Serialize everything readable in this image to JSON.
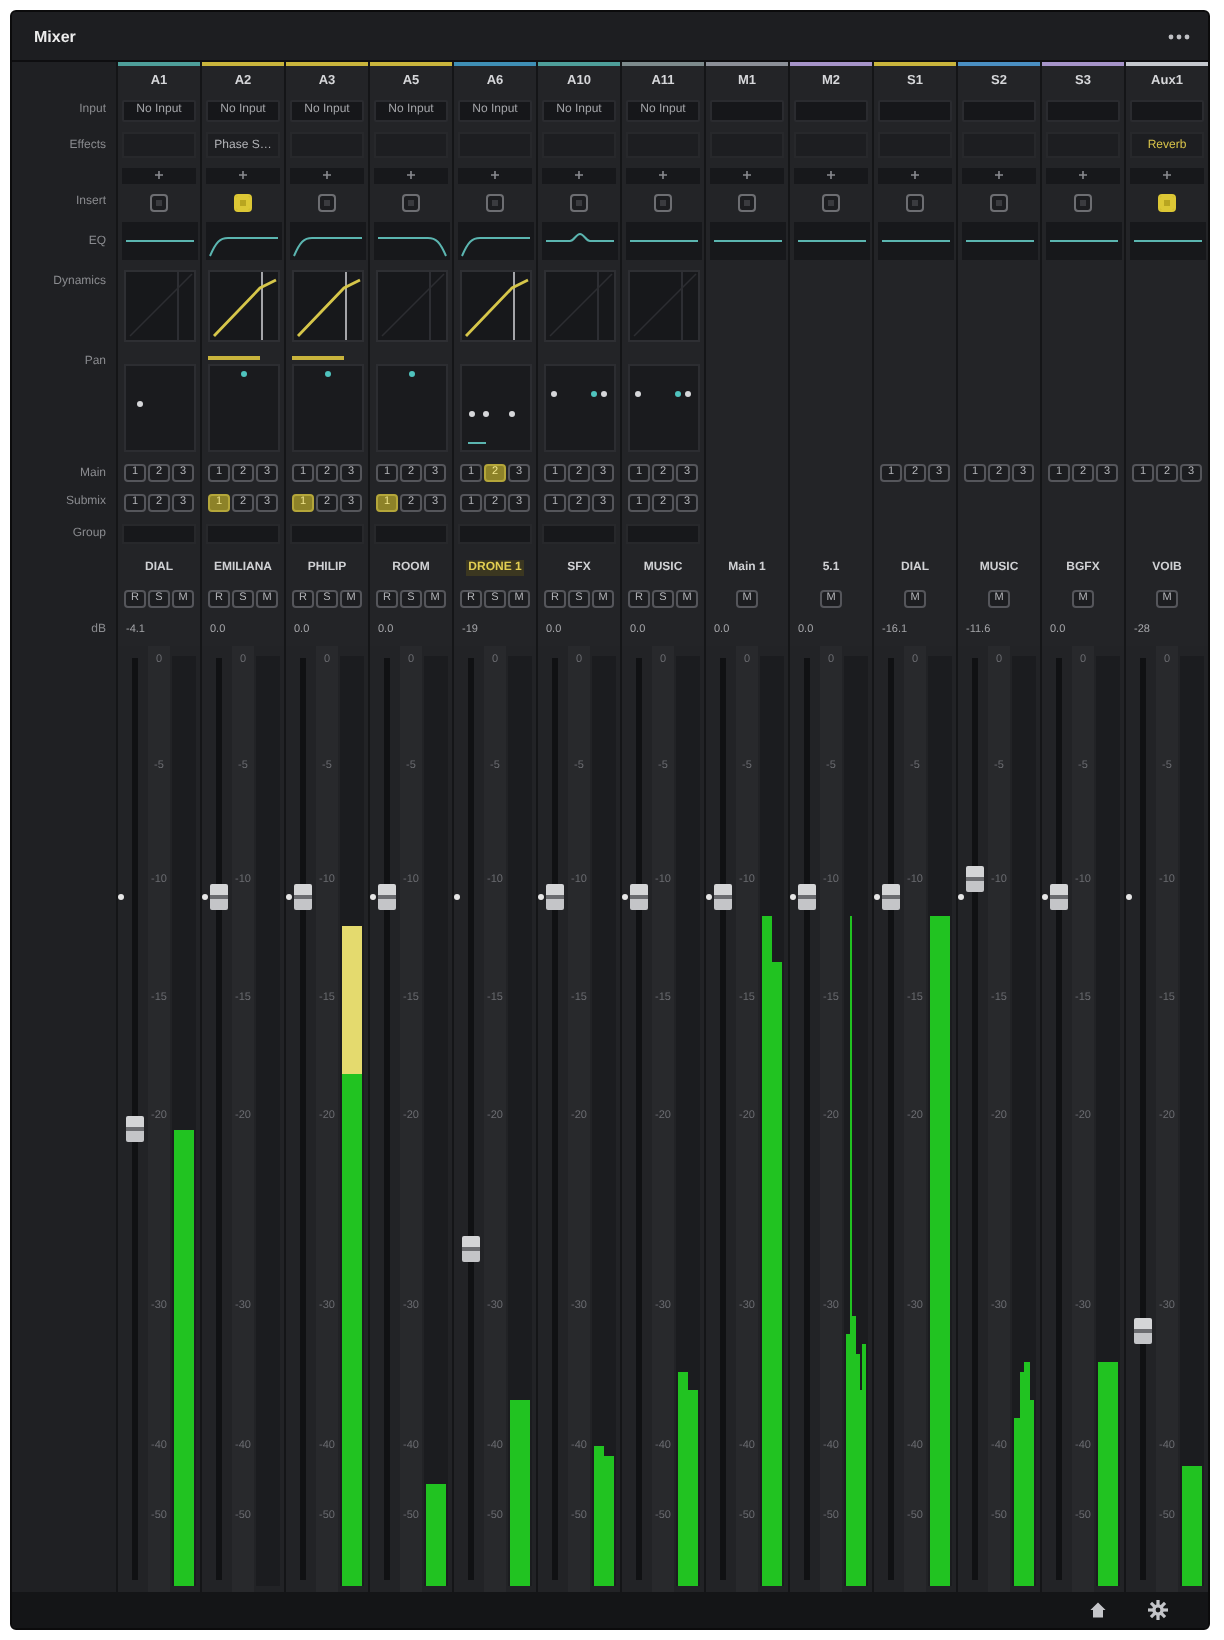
{
  "window": {
    "title": "Mixer"
  },
  "labels": {
    "input": "Input",
    "effects": "Effects",
    "insert": "Insert",
    "eq": "EQ",
    "dynamics": "Dynamics",
    "pan": "Pan",
    "main": "Main",
    "submix": "Submix",
    "group": "Group",
    "db": "dB"
  },
  "channels": [
    {
      "kind": "track",
      "header": "A1",
      "color": "#4e9f9a",
      "input": "No Input",
      "insert": false,
      "eq": {
        "kind": "flat"
      },
      "dynamics": {
        "active": false
      },
      "pan": {
        "kind": "left",
        "width_bar": false
      },
      "main": [
        {
          "label": "1",
          "selected": false
        },
        {
          "label": "2",
          "selected": false
        },
        {
          "label": "3",
          "selected": false
        }
      ],
      "submix": [
        {
          "label": "1",
          "selected": false
        },
        {
          "label": "2",
          "selected": false
        },
        {
          "label": "3",
          "selected": false
        }
      ],
      "name": "DIAL",
      "selected": false,
      "buttons": [
        "R",
        "S",
        "M"
      ],
      "db": "-4.1",
      "fader": {
        "level": 0.49
      },
      "scale": [
        "0",
        "-5",
        "-10",
        "-15",
        "-20",
        "-30",
        "-40",
        "-50"
      ],
      "meter": [
        {
          "segments": [
            {
              "level": 0.49,
              "color": "#21c321"
            }
          ]
        }
      ]
    },
    {
      "kind": "track",
      "header": "A2",
      "color": "#c9b43c",
      "input": "No Input",
      "effect": {
        "name": "Phase S…",
        "active": false
      },
      "insert": true,
      "eq": {
        "kind": "high-pass"
      },
      "dynamics": {
        "active": true
      },
      "pan": {
        "kind": "front",
        "width_bar": true
      },
      "main": [
        {
          "label": "1",
          "selected": false
        },
        {
          "label": "2",
          "selected": false
        },
        {
          "label": "3",
          "selected": false
        }
      ],
      "submix": [
        {
          "label": "1",
          "selected": true
        },
        {
          "label": "2",
          "selected": false
        },
        {
          "label": "3",
          "selected": false
        }
      ],
      "name": "EMILIANA",
      "selected": false,
      "buttons": [
        "R",
        "S",
        "M"
      ],
      "db": "0.0",
      "fader": {
        "level": 0.74
      },
      "scale": [
        "0",
        "-5",
        "-10",
        "-15",
        "-20",
        "-30",
        "-40",
        "-50"
      ]
    },
    {
      "kind": "track",
      "header": "A3",
      "color": "#c9b43c",
      "input": "No Input",
      "insert": false,
      "eq": {
        "kind": "high-pass"
      },
      "dynamics": {
        "active": true
      },
      "pan": {
        "kind": "front",
        "width_bar": true
      },
      "main": [
        {
          "label": "1",
          "selected": false
        },
        {
          "label": "2",
          "selected": false
        },
        {
          "label": "3",
          "selected": false
        }
      ],
      "submix": [
        {
          "label": "1",
          "selected": true
        },
        {
          "label": "2",
          "selected": false
        },
        {
          "label": "3",
          "selected": false
        }
      ],
      "name": "PHILIP",
      "selected": false,
      "buttons": [
        "R",
        "S",
        "M"
      ],
      "db": "0.0",
      "fader": {
        "level": 0.74
      },
      "scale": [
        "0",
        "-5",
        "-10",
        "-15",
        "-20",
        "-30",
        "-40",
        "-50"
      ],
      "meter": [
        {
          "segments": [
            {
              "level": 0.71,
              "color": "#e4da6e"
            },
            {
              "level": 0.55,
              "color": "#21c321"
            }
          ]
        }
      ]
    },
    {
      "kind": "track",
      "header": "A5",
      "color": "#c9b43c",
      "input": "No Input",
      "insert": false,
      "eq": {
        "kind": "low-pass"
      },
      "dynamics": {
        "active": false
      },
      "pan": {
        "kind": "front",
        "width_bar": false
      },
      "main": [
        {
          "label": "1",
          "selected": false
        },
        {
          "label": "2",
          "selected": false
        },
        {
          "label": "3",
          "selected": false
        }
      ],
      "submix": [
        {
          "label": "1",
          "selected": true
        },
        {
          "label": "2",
          "selected": false
        },
        {
          "label": "3",
          "selected": false
        }
      ],
      "name": "ROOM",
      "selected": false,
      "buttons": [
        "R",
        "S",
        "M"
      ],
      "db": "0.0",
      "fader": {
        "level": 0.74
      },
      "scale": [
        "0",
        "-5",
        "-10",
        "-15",
        "-20",
        "-30",
        "-40",
        "-50"
      ],
      "meter": [
        {
          "segments": [
            {
              "level": 0.11,
              "color": "#21c321"
            }
          ]
        }
      ]
    },
    {
      "kind": "track",
      "header": "A6",
      "color": "#3f8fb5",
      "input": "No Input",
      "insert": false,
      "eq": {
        "kind": "high-pass"
      },
      "dynamics": {
        "active": true
      },
      "pan": {
        "kind": "surround",
        "width_bar": false
      },
      "main": [
        {
          "label": "1",
          "selected": false
        },
        {
          "label": "2",
          "selected": true
        },
        {
          "label": "3",
          "selected": false
        }
      ],
      "submix": [
        {
          "label": "1",
          "selected": false
        },
        {
          "label": "2",
          "selected": false
        },
        {
          "label": "3",
          "selected": false
        }
      ],
      "name": "DRONE 1",
      "selected": true,
      "buttons": [
        "R",
        "S",
        "M"
      ],
      "db": "-19",
      "fader": {
        "level": 0.36
      },
      "scale": [
        "0",
        "-5",
        "-10",
        "-15",
        "-20",
        "-30",
        "-40",
        "-50"
      ],
      "meter": [
        {
          "segments": [
            {
              "level": 0.2,
              "color": "#21c321"
            }
          ]
        }
      ]
    },
    {
      "kind": "track",
      "header": "A10",
      "color": "#4e9f9a",
      "input": "No Input",
      "insert": false,
      "eq": {
        "kind": "bell"
      },
      "dynamics": {
        "active": false
      },
      "pan": {
        "kind": "stereo",
        "width_bar": false
      },
      "main": [
        {
          "label": "1",
          "selected": false
        },
        {
          "label": "2",
          "selected": false
        },
        {
          "label": "3",
          "selected": false
        }
      ],
      "submix": [
        {
          "label": "1",
          "selected": false
        },
        {
          "label": "2",
          "selected": false
        },
        {
          "label": "3",
          "selected": false
        }
      ],
      "name": "SFX",
      "selected": false,
      "buttons": [
        "R",
        "S",
        "M"
      ],
      "db": "0.0",
      "fader": {
        "level": 0.74
      },
      "scale": [
        "0",
        "-5",
        "-10",
        "-15",
        "-20",
        "-30",
        "-40",
        "-50"
      ],
      "meter": [
        {
          "segments": [
            {
              "level": 0.15,
              "color": "#21c321"
            }
          ]
        },
        {
          "segments": [
            {
              "level": 0.14,
              "color": "#21c321"
            }
          ]
        }
      ]
    },
    {
      "kind": "track",
      "header": "A11",
      "color": "#7d8a8c",
      "input": "No Input",
      "insert": false,
      "eq": {
        "kind": "flat"
      },
      "dynamics": {
        "active": false
      },
      "pan": {
        "kind": "stereo",
        "width_bar": false
      },
      "main": [
        {
          "label": "1",
          "selected": false
        },
        {
          "label": "2",
          "selected": false
        },
        {
          "label": "3",
          "selected": false
        }
      ],
      "submix": [
        {
          "label": "1",
          "selected": false
        },
        {
          "label": "2",
          "selected": false
        },
        {
          "label": "3",
          "selected": false
        }
      ],
      "name": "MUSIC",
      "selected": false,
      "buttons": [
        "R",
        "S",
        "M"
      ],
      "db": "0.0",
      "fader": {
        "level": 0.74
      },
      "scale": [
        "0",
        "-5",
        "-10",
        "-15",
        "-20",
        "-30",
        "-40",
        "-50"
      ],
      "meter": [
        {
          "segments": [
            {
              "level": 0.23,
              "color": "#21c321"
            }
          ]
        },
        {
          "segments": [
            {
              "level": 0.21,
              "color": "#21c321"
            }
          ]
        }
      ]
    },
    {
      "kind": "bus",
      "header": "M1",
      "color": "#8c9098",
      "insert": false,
      "eq": {
        "kind": "flat"
      },
      "name": "Main 1",
      "selected": false,
      "buttons": [
        "M"
      ],
      "db": "0.0",
      "fader": {
        "level": 0.74
      },
      "scale": [
        "0",
        "-5",
        "-10",
        "-15",
        "-20",
        "-30",
        "-40",
        "-50"
      ],
      "meter": [
        {
          "segments": [
            {
              "level": 0.72,
              "color": "#21c321"
            }
          ]
        },
        {
          "segments": [
            {
              "level": 0.67,
              "color": "#21c321"
            }
          ]
        }
      ]
    },
    {
      "kind": "bus",
      "header": "M2",
      "color": "#a694c9",
      "insert": false,
      "eq": {
        "kind": "flat"
      },
      "name": "5.1",
      "selected": false,
      "buttons": [
        "M"
      ],
      "db": "0.0",
      "fader": {
        "level": 0.74
      },
      "scale": [
        "0",
        "-5",
        "-10",
        "-15",
        "-20",
        "-30",
        "-40",
        "-50"
      ],
      "meter": [
        {
          "segments": [
            {
              "level": 0.27,
              "color": "#21c321"
            }
          ]
        },
        {
          "segments": [
            {
              "level": 0.72,
              "color": "#21c321"
            }
          ]
        },
        {
          "segments": [
            {
              "level": 0.29,
              "color": "#21c321"
            }
          ]
        },
        {
          "segments": [
            {
              "level": 0.25,
              "color": "#21c321"
            }
          ]
        },
        {
          "segments": [
            {
              "level": 0.21,
              "color": "#21c321"
            }
          ]
        },
        {
          "segments": [
            {
              "level": 0.26,
              "color": "#21c321"
            }
          ]
        }
      ]
    },
    {
      "kind": "bus",
      "header": "S1",
      "color": "#c9b43c",
      "insert": false,
      "eq": {
        "kind": "flat"
      },
      "main": [
        {
          "label": "1",
          "selected": false
        },
        {
          "label": "2",
          "selected": false
        },
        {
          "label": "3",
          "selected": false
        }
      ],
      "name": "DIAL",
      "selected": false,
      "buttons": [
        "M"
      ],
      "db": "-16.1",
      "fader": {
        "level": 0.74
      },
      "scale": [
        "0",
        "-5",
        "-10",
        "-15",
        "-20",
        "-30",
        "-40",
        "-50"
      ],
      "meter": [
        {
          "segments": [
            {
              "level": 0.72,
              "color": "#21c321"
            }
          ]
        }
      ]
    },
    {
      "kind": "bus",
      "header": "S2",
      "color": "#4a8fc2",
      "insert": false,
      "eq": {
        "kind": "flat"
      },
      "main": [
        {
          "label": "1",
          "selected": false
        },
        {
          "label": "2",
          "selected": false
        },
        {
          "label": "3",
          "selected": false
        }
      ],
      "name": "MUSIC",
      "selected": false,
      "buttons": [
        "M"
      ],
      "db": "-11.6",
      "fader": {
        "level": 0.76
      },
      "scale": [
        "0",
        "-5",
        "-10",
        "-15",
        "-20",
        "-30",
        "-40",
        "-50"
      ],
      "meter": [
        {
          "segments": [
            {
              "level": 0.18,
              "color": "#21c321"
            }
          ]
        },
        {
          "segments": [
            {
              "level": 0.23,
              "color": "#21c321"
            }
          ]
        },
        {
          "segments": [
            {
              "level": 0.24,
              "color": "#21c321"
            }
          ]
        },
        {
          "segments": [
            {
              "level": 0.2,
              "color": "#21c321"
            }
          ]
        }
      ]
    },
    {
      "kind": "bus",
      "header": "S3",
      "color": "#a694c9",
      "insert": false,
      "eq": {
        "kind": "flat"
      },
      "main": [
        {
          "label": "1",
          "selected": false
        },
        {
          "label": "2",
          "selected": false
        },
        {
          "label": "3",
          "selected": false
        }
      ],
      "name": "BGFX",
      "selected": false,
      "buttons": [
        "M"
      ],
      "db": "0.0",
      "fader": {
        "level": 0.74
      },
      "scale": [
        "0",
        "-5",
        "-10",
        "-15",
        "-20",
        "-30",
        "-40",
        "-50"
      ],
      "meter": [
        {
          "segments": [
            {
              "level": 0.24,
              "color": "#21c321"
            }
          ]
        },
        {
          "segments": [
            {
              "level": 0.24,
              "color": "#21c321"
            }
          ]
        }
      ]
    },
    {
      "kind": "bus",
      "header": "Aux1",
      "color": "#c4c7cd",
      "effect": {
        "name": "Reverb",
        "active": true
      },
      "insert": true,
      "eq": {
        "kind": "flat"
      },
      "main": [
        {
          "label": "1",
          "selected": false
        },
        {
          "label": "2",
          "selected": false
        },
        {
          "label": "3",
          "selected": false
        }
      ],
      "name": "VOIB",
      "selected": false,
      "buttons": [
        "M"
      ],
      "db": "-28",
      "fader": {
        "level": 0.27
      },
      "scale": [
        "0",
        "-5",
        "-10",
        "-15",
        "-20",
        "-30",
        "-40",
        "-50"
      ],
      "meter": [
        {
          "segments": [
            {
              "level": 0.13,
              "color": "#21c321"
            }
          ]
        }
      ]
    }
  ]
}
